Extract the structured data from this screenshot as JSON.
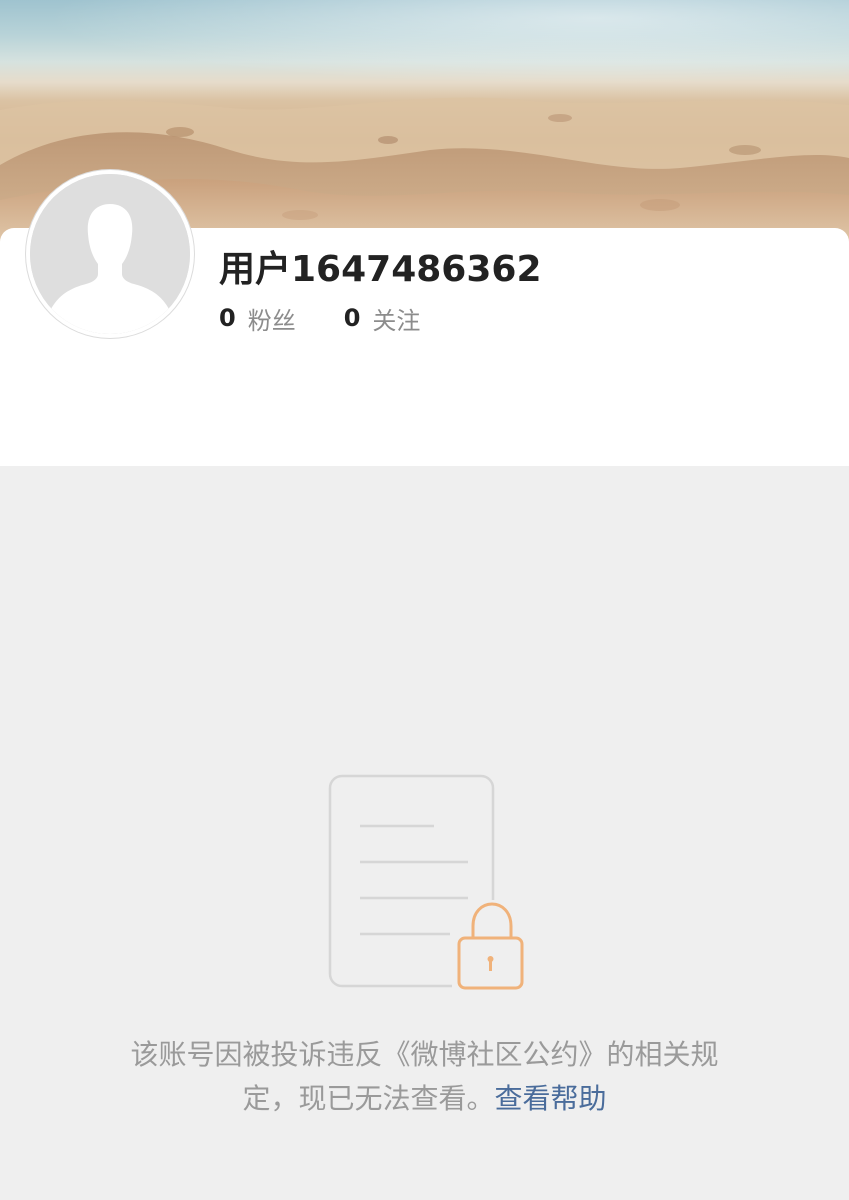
{
  "profile": {
    "username": "用户1647486362",
    "stats": [
      {
        "value": "0",
        "label": "粉丝"
      },
      {
        "value": "0",
        "label": "关注"
      }
    ]
  },
  "blocked": {
    "message_line1": "该账号因被投诉违反《微博社区公约》的相关规",
    "message_line2": "定，现已无法查看。",
    "help_link": "查看帮助"
  },
  "colors": {
    "link": "#4a6c9b",
    "lock_icon": "#f0b27a",
    "background": "#efefef"
  },
  "icons": {
    "avatar": "default-person-silhouette",
    "blocked": "document-lock-icon"
  }
}
